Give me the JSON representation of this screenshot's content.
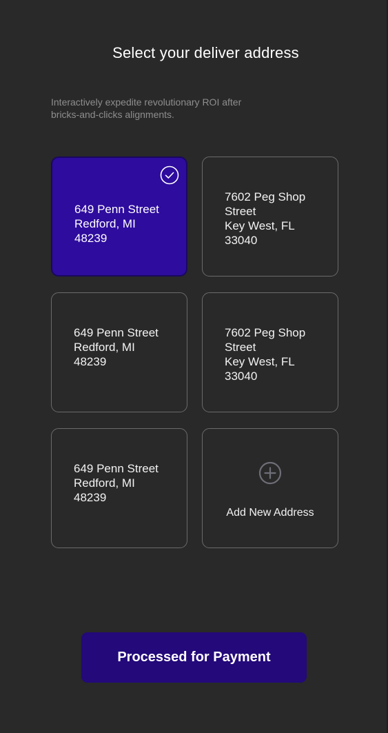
{
  "header": {
    "title": "Select your deliver address",
    "subtitle": "Interactively expedite revolutionary ROI after bricks-and-clicks alignments."
  },
  "addresses": [
    {
      "line1": "649 Penn Street",
      "line2": "Redford, MI",
      "line3": "48239",
      "selected": true,
      "icon": "check-circle-icon"
    },
    {
      "line1": "7602 Peg Shop",
      "line2": "Street",
      "line3": "Key West, FL",
      "line4": "33040",
      "selected": false
    },
    {
      "line1": "649 Penn Street",
      "line2": "Redford, MI",
      "line3": "48239",
      "selected": false
    },
    {
      "line1": "7602 Peg Shop",
      "line2": "Street",
      "line3": "Key West, FL",
      "line4": "33040",
      "selected": false
    },
    {
      "line1": "649 Penn Street",
      "line2": "Redford, MI",
      "line3": "48239",
      "selected": false
    }
  ],
  "add_address": {
    "label": "Add New Address",
    "icon": "plus-circle-icon"
  },
  "cta": {
    "label": "Processed for Payment"
  },
  "colors": {
    "background": "#292929",
    "selected_card": "#2e0c9e",
    "button": "#23097a",
    "card_border": "#6b6b6b",
    "subtitle": "#8e8e8e"
  }
}
